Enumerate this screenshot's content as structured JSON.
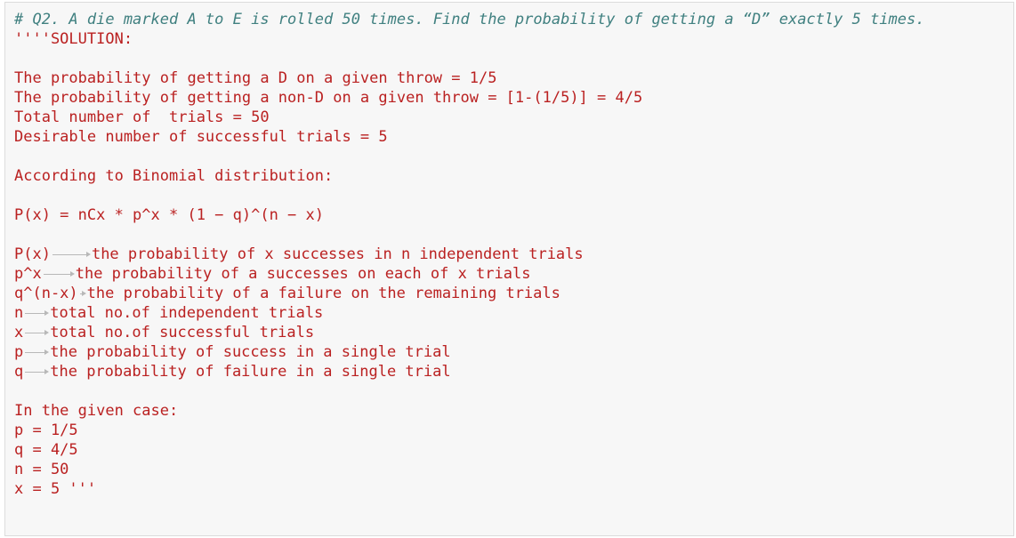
{
  "cell": {
    "comment": "# Q2. A die marked A to E is rolled 50 times. Find the probability of getting a “D” exactly 5 times.",
    "lines": [
      "''''SOLUTION:",
      "",
      "The probability of getting a D on a given throw = 1/5",
      "The probability of getting a non-D on a given throw = [1-(1/5)] = 4/5",
      "Total number of  trials = 50",
      "Desirable number of successful trials = 5",
      "",
      "According to Binomial distribution:",
      "",
      "P(x) = nCx * p^x * (1 − q)^(n − x)",
      "",
      "P(x)",
      "the probability of x successes in n independent trials",
      "p^x",
      "the probability of a successes on each of x trials",
      "q^(n-x)",
      "the probability of a failure on the remaining trials",
      "n",
      "total no.of independent trials",
      "x",
      "total no.of successful trials",
      "p",
      "the probability of success in a single trial",
      "q",
      "the probability of failure in a single trial",
      "",
      "In the given case:",
      "p = 1/5",
      "q = 4/5",
      "n = 50",
      "x = 5 '''"
    ]
  }
}
